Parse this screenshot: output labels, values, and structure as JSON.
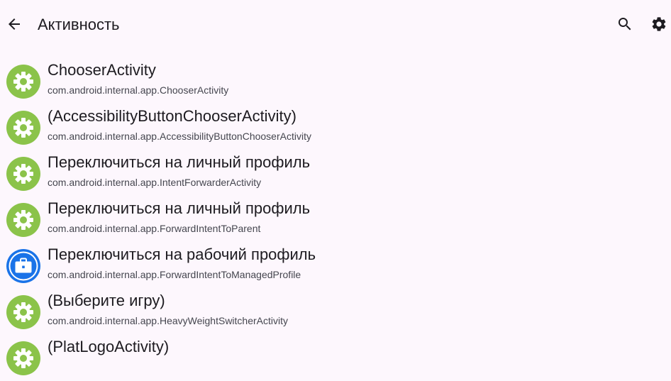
{
  "appbar": {
    "title": "Активность",
    "back_icon": "arrow-back-icon",
    "search_icon": "search-icon",
    "settings_icon": "gear-icon"
  },
  "colors": {
    "background": "#fdf7fd",
    "android_icon_green": "#8bc34a",
    "work_icon_blue": "#1a73e8"
  },
  "activities": [
    {
      "label": "ChooserActivity",
      "class_name": "com.android.internal.app.ChooserActivity",
      "icon": "android-gear-icon"
    },
    {
      "label": "(AccessibilityButtonChooserActivity)",
      "class_name": "com.android.internal.app.AccessibilityButtonChooserActivity",
      "icon": "android-gear-icon"
    },
    {
      "label": "Переключиться на личный профиль",
      "class_name": "com.android.internal.app.IntentForwarderActivity",
      "icon": "android-gear-icon"
    },
    {
      "label": "Переключиться на личный профиль",
      "class_name": "com.android.internal.app.ForwardIntentToParent",
      "icon": "android-gear-icon"
    },
    {
      "label": "Переключиться на рабочий профиль",
      "class_name": "com.android.internal.app.ForwardIntentToManagedProfile",
      "icon": "briefcase-icon"
    },
    {
      "label": "(Выберите игру)",
      "class_name": "com.android.internal.app.HeavyWeightSwitcherActivity",
      "icon": "android-gear-icon"
    },
    {
      "label": "(PlatLogoActivity)",
      "class_name": "",
      "icon": "android-gear-icon"
    }
  ]
}
